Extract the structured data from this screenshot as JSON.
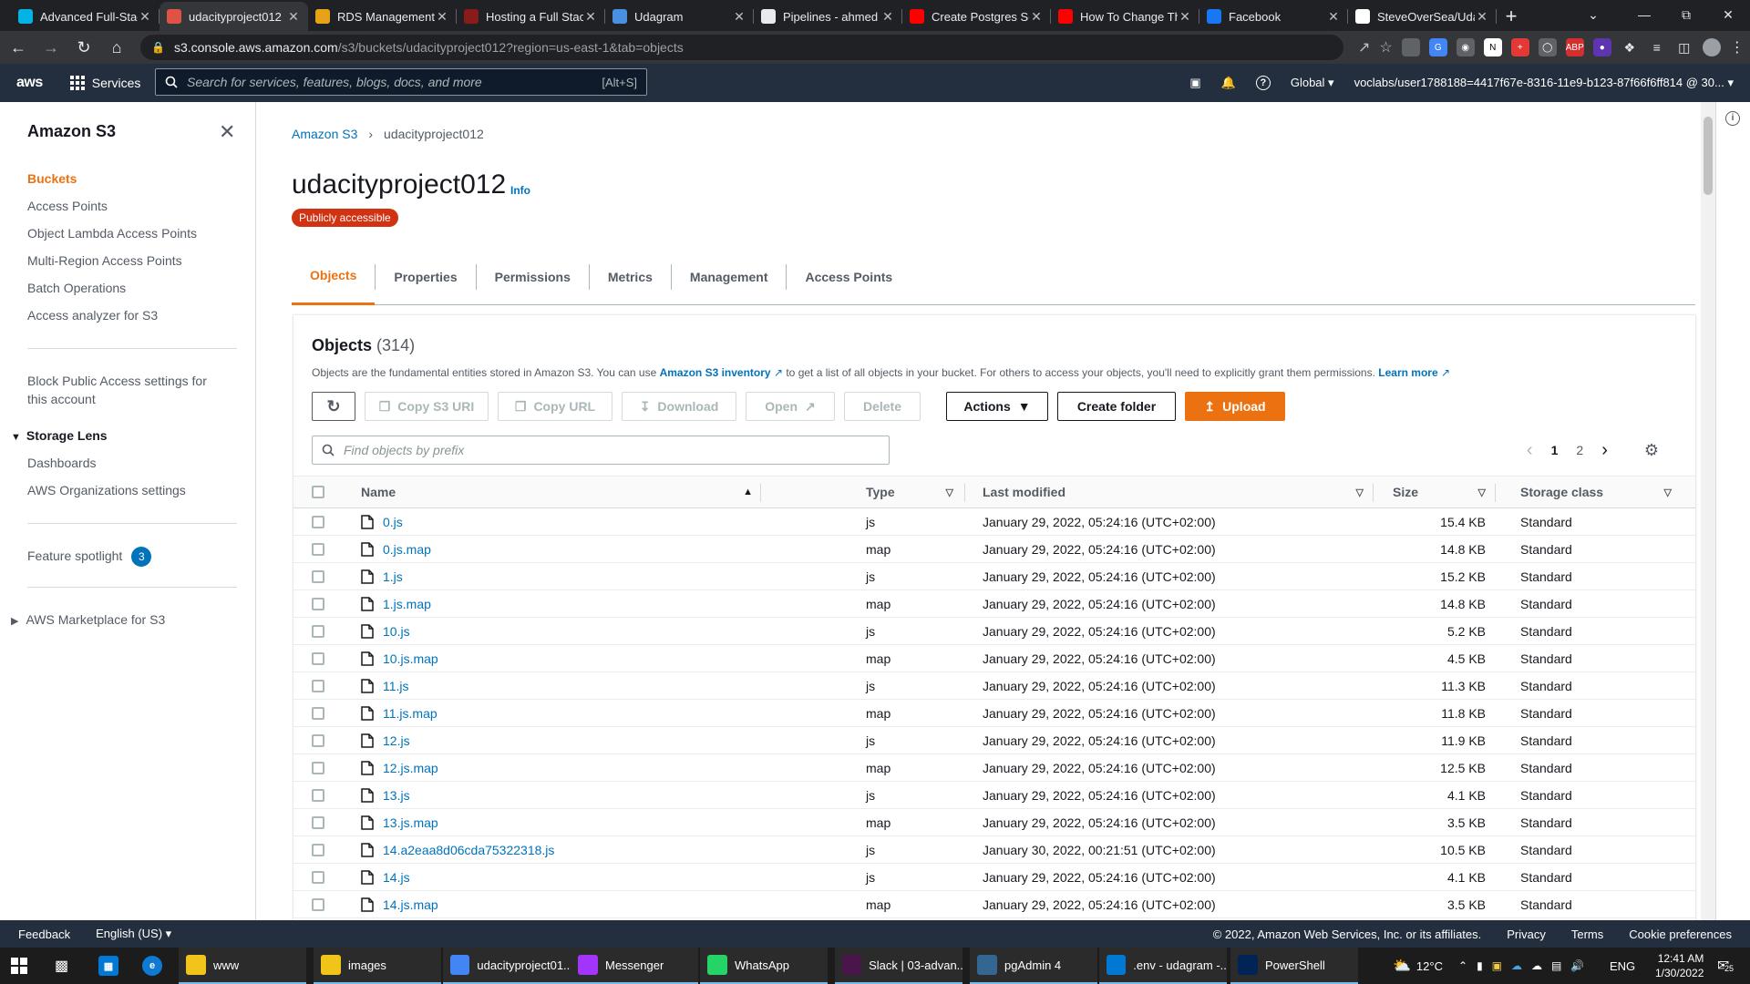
{
  "browser": {
    "tabs": [
      {
        "title": "Advanced Full-Stac",
        "icon": "udacity-icon",
        "color": "#02b3e4",
        "active": false
      },
      {
        "title": "udacityproject012",
        "icon": "aws-s3-icon",
        "color": "#e05243",
        "active": true
      },
      {
        "title": "RDS Management",
        "icon": "aws-rds-icon",
        "color": "#e7a317",
        "active": false
      },
      {
        "title": "Hosting a Full Stac",
        "icon": "hosting-icon",
        "color": "#8b1a1a",
        "active": false
      },
      {
        "title": "Udagram",
        "icon": "react-icon",
        "color": "#4a90e2",
        "active": false
      },
      {
        "title": "Pipelines - ahmed",
        "icon": "circleci-icon",
        "color": "#e8eaed",
        "active": false
      },
      {
        "title": "Create Postgres Se",
        "icon": "youtube-icon",
        "color": "#ff0000",
        "active": false
      },
      {
        "title": "How To Change Th",
        "icon": "youtube-icon",
        "color": "#ff0000",
        "active": false
      },
      {
        "title": "Facebook",
        "icon": "facebook-icon",
        "color": "#1877f2",
        "active": false
      },
      {
        "title": "SteveOverSea/Uda",
        "icon": "github-icon",
        "color": "#ffffff",
        "active": false
      }
    ],
    "url_host": "s3.console.aws.amazon.com",
    "url_path": "/s3/buckets/udacityproject012?region=us-east-1&tab=objects"
  },
  "awsnav": {
    "logo": "aws",
    "services": "Services",
    "search_placeholder": "Search for services, features, blogs, docs, and more",
    "search_shortcut": "[Alt+S]",
    "region": "Global",
    "account": "voclabs/user1788188=4417f67e-8316-11e9-b123-87f66f6ff814 @ 30..."
  },
  "sidebar": {
    "title": "Amazon S3",
    "items": [
      "Buckets",
      "Access Points",
      "Object Lambda Access Points",
      "Multi-Region Access Points",
      "Batch Operations",
      "Access analyzer for S3"
    ],
    "block_public_line1": "Block Public Access settings for",
    "block_public_line2": "this account",
    "storage_lens": "Storage Lens",
    "storage_lens_items": [
      "Dashboards",
      "AWS Organizations settings"
    ],
    "feature_spotlight": "Feature spotlight",
    "feature_count": "3",
    "marketplace": "AWS Marketplace for S3"
  },
  "main": {
    "breadcrumb_root": "Amazon S3",
    "breadcrumb_current": "udacityproject012",
    "title": "udacityproject012",
    "info": "Info",
    "badge": "Publicly accessible",
    "tabs": [
      "Objects",
      "Properties",
      "Permissions",
      "Metrics",
      "Management",
      "Access Points"
    ]
  },
  "objects": {
    "heading": "Objects",
    "count": "(314)",
    "desc_a": "Objects are the fundamental entities stored in Amazon S3. You can use ",
    "desc_link": "Amazon S3 inventory",
    "desc_b": " to get a list of all objects in your bucket. For others to access your objects, you'll need to explicitly grant them permissions. ",
    "learn_more": "Learn more",
    "buttons": {
      "copy_uri": "Copy S3 URI",
      "copy_url": "Copy URL",
      "download": "Download",
      "open": "Open",
      "delete": "Delete",
      "actions": "Actions",
      "create_folder": "Create folder",
      "upload": "Upload"
    },
    "find_placeholder": "Find objects by prefix",
    "pages": [
      "1",
      "2"
    ],
    "columns": [
      "Name",
      "Type",
      "Last modified",
      "Size",
      "Storage class"
    ],
    "rows": [
      {
        "name": "0.js",
        "type": "js",
        "modified": "January 29, 2022, 05:24:16 (UTC+02:00)",
        "size": "15.4 KB",
        "class": "Standard"
      },
      {
        "name": "0.js.map",
        "type": "map",
        "modified": "January 29, 2022, 05:24:16 (UTC+02:00)",
        "size": "14.8 KB",
        "class": "Standard"
      },
      {
        "name": "1.js",
        "type": "js",
        "modified": "January 29, 2022, 05:24:16 (UTC+02:00)",
        "size": "15.2 KB",
        "class": "Standard"
      },
      {
        "name": "1.js.map",
        "type": "map",
        "modified": "January 29, 2022, 05:24:16 (UTC+02:00)",
        "size": "14.8 KB",
        "class": "Standard"
      },
      {
        "name": "10.js",
        "type": "js",
        "modified": "January 29, 2022, 05:24:16 (UTC+02:00)",
        "size": "5.2 KB",
        "class": "Standard"
      },
      {
        "name": "10.js.map",
        "type": "map",
        "modified": "January 29, 2022, 05:24:16 (UTC+02:00)",
        "size": "4.5 KB",
        "class": "Standard"
      },
      {
        "name": "11.js",
        "type": "js",
        "modified": "January 29, 2022, 05:24:16 (UTC+02:00)",
        "size": "11.3 KB",
        "class": "Standard"
      },
      {
        "name": "11.js.map",
        "type": "map",
        "modified": "January 29, 2022, 05:24:16 (UTC+02:00)",
        "size": "11.8 KB",
        "class": "Standard"
      },
      {
        "name": "12.js",
        "type": "js",
        "modified": "January 29, 2022, 05:24:16 (UTC+02:00)",
        "size": "11.9 KB",
        "class": "Standard"
      },
      {
        "name": "12.js.map",
        "type": "map",
        "modified": "January 29, 2022, 05:24:16 (UTC+02:00)",
        "size": "12.5 KB",
        "class": "Standard"
      },
      {
        "name": "13.js",
        "type": "js",
        "modified": "January 29, 2022, 05:24:16 (UTC+02:00)",
        "size": "4.1 KB",
        "class": "Standard"
      },
      {
        "name": "13.js.map",
        "type": "map",
        "modified": "January 29, 2022, 05:24:16 (UTC+02:00)",
        "size": "3.5 KB",
        "class": "Standard"
      },
      {
        "name": "14.a2eaa8d06cda75322318.js",
        "type": "js",
        "modified": "January 30, 2022, 00:21:51 (UTC+02:00)",
        "size": "10.5 KB",
        "class": "Standard"
      },
      {
        "name": "14.js",
        "type": "js",
        "modified": "January 29, 2022, 05:24:16 (UTC+02:00)",
        "size": "4.1 KB",
        "class": "Standard"
      },
      {
        "name": "14.js.map",
        "type": "map",
        "modified": "January 29, 2022, 05:24:16 (UTC+02:00)",
        "size": "3.5 KB",
        "class": "Standard"
      }
    ]
  },
  "footer": {
    "feedback": "Feedback",
    "language": "English (US)",
    "copyright": "© 2022, Amazon Web Services, Inc. or its affiliates.",
    "privacy": "Privacy",
    "terms": "Terms",
    "cookies": "Cookie preferences"
  },
  "taskbar": {
    "apps": [
      {
        "label": "www",
        "icon": "folder-icon",
        "color": "#f0c419"
      },
      {
        "label": "images",
        "icon": "folder-icon",
        "color": "#f0c419"
      },
      {
        "label": "udacityproject01...",
        "icon": "chrome-icon",
        "color": "#4285f4"
      },
      {
        "label": "Messenger",
        "icon": "messenger-icon",
        "color": "#a334fa"
      },
      {
        "label": "WhatsApp",
        "icon": "whatsapp-icon",
        "color": "#25d366"
      },
      {
        "label": "Slack | 03-advan...",
        "icon": "slack-icon",
        "color": "#4a154b"
      },
      {
        "label": "pgAdmin 4",
        "icon": "pgadmin-icon",
        "color": "#336791"
      },
      {
        "label": ".env - udagram -...",
        "icon": "vscode-icon",
        "color": "#0078d4"
      },
      {
        "label": "PowerShell",
        "icon": "powershell-icon",
        "color": "#012456"
      }
    ],
    "temperature": "12°C",
    "lang": "ENG",
    "time": "12:41 AM",
    "date": "1/30/2022",
    "notif": "25"
  }
}
